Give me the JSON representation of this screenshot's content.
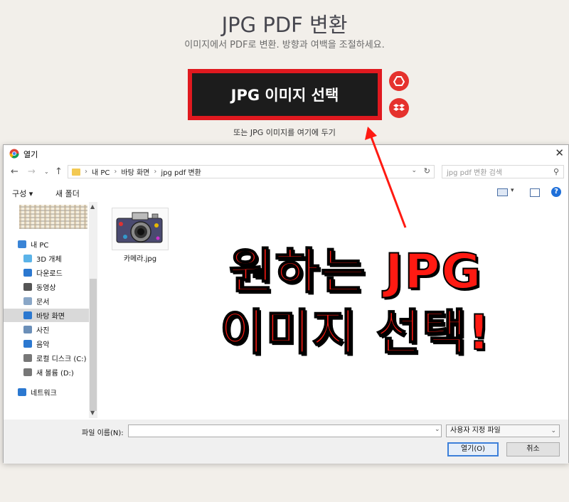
{
  "page": {
    "title": "JPG PDF 변환",
    "subtitle": "이미지에서 PDF로 변환. 방향과 여백을 조절하세요.",
    "select_button": "JPG 이미지 선택",
    "drop_hint": "또는 JPG 이미지를 여기에 두기"
  },
  "dialog": {
    "title": "열기",
    "breadcrumb": [
      "내 PC",
      "바탕 화면",
      "jpg pdf 변환"
    ],
    "search_placeholder": "jpg pdf 변환 검색",
    "organize": "구성 ▾",
    "new_folder": "새 폴더",
    "sidebar": [
      {
        "label": "내 PC",
        "icon": "pc-icon",
        "indent": false
      },
      {
        "label": "3D 개체",
        "icon": "cube-icon",
        "indent": true
      },
      {
        "label": "다운로드",
        "icon": "download-icon",
        "indent": true
      },
      {
        "label": "동영상",
        "icon": "video-icon",
        "indent": true
      },
      {
        "label": "문서",
        "icon": "document-icon",
        "indent": true
      },
      {
        "label": "바탕 화면",
        "icon": "desktop-icon",
        "indent": true,
        "selected": true
      },
      {
        "label": "사진",
        "icon": "picture-icon",
        "indent": true
      },
      {
        "label": "음악",
        "icon": "music-icon",
        "indent": true
      },
      {
        "label": "로컬 디스크 (C:)",
        "icon": "drive-icon",
        "indent": true
      },
      {
        "label": "새 볼륨 (D:)",
        "icon": "drive-icon",
        "indent": true
      },
      {
        "label": "네트워크",
        "icon": "network-icon",
        "indent": false
      }
    ],
    "file": {
      "name": "카메라.jpg"
    },
    "filename_label": "파일 이름(N):",
    "filename_value": "",
    "file_type": "사용자 지정 파일",
    "open_button": "열기(O)",
    "cancel_button": "취소"
  },
  "annotation": {
    "line1": "원하는 JPG",
    "line2": "이미지 선택!"
  },
  "colors": {
    "accent_red": "#e5322d",
    "annotation_red": "#ff1a12",
    "button_dark": "#1c1c1c"
  }
}
